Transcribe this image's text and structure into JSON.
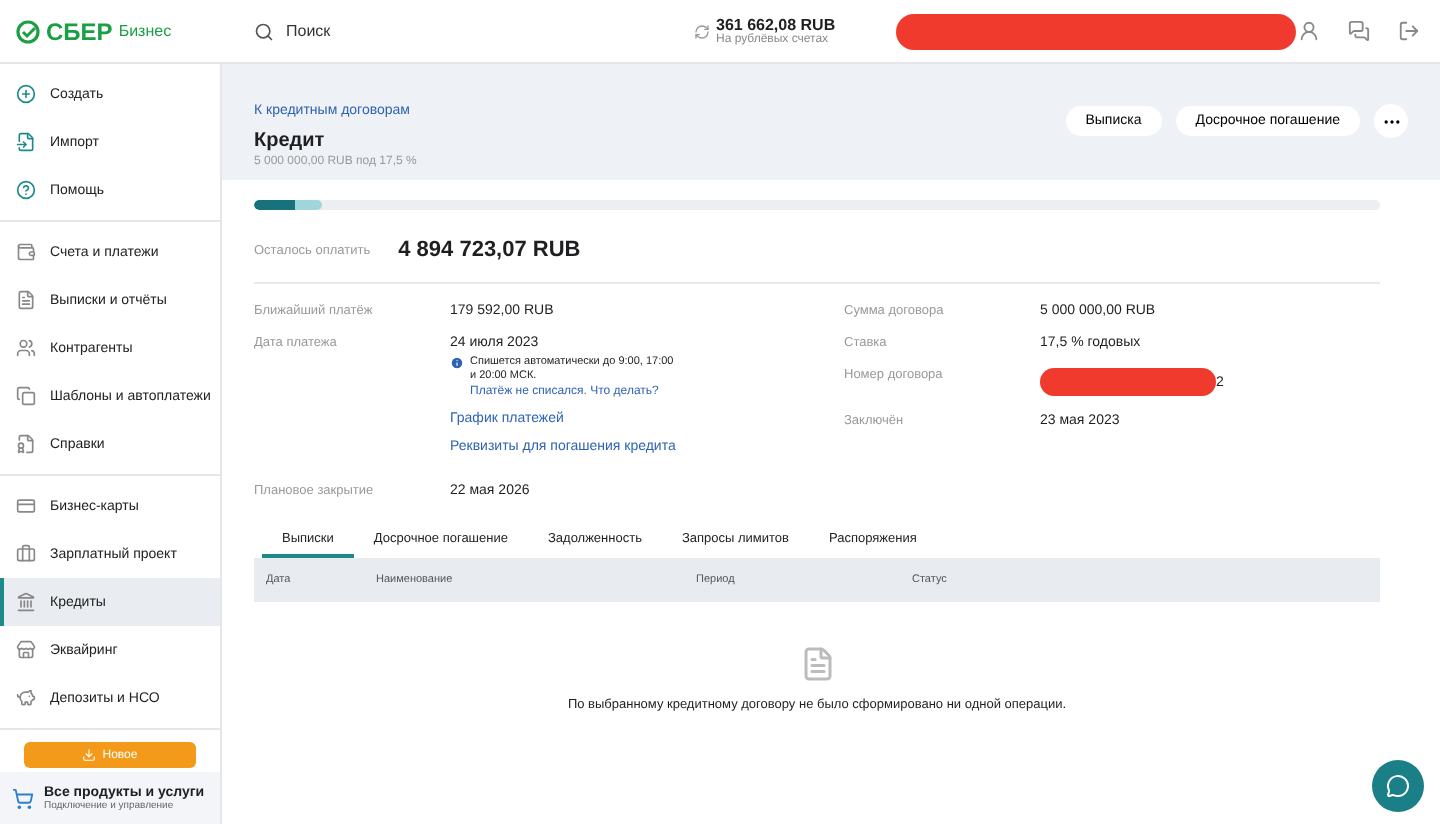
{
  "header": {
    "brand": "СБЕР",
    "product": "Бизнес",
    "search_placeholder": "Поиск",
    "balance": "361 662,08 RUB",
    "balance_caption": "На рублёвых счетах"
  },
  "sidebar": {
    "groups": [
      [
        {
          "label": "Создать",
          "selected": false
        },
        {
          "label": "Импорт",
          "selected": false
        },
        {
          "label": "Помощь",
          "selected": false
        }
      ],
      [
        {
          "label": "Счета и платежи",
          "selected": false
        },
        {
          "label": "Выписки и отчёты",
          "selected": false
        },
        {
          "label": "Контрагенты",
          "selected": false
        },
        {
          "label": "Шаблоны и автоплатежи",
          "selected": false
        },
        {
          "label": "Справки",
          "selected": false
        }
      ],
      [
        {
          "label": "Бизнес-карты",
          "selected": false
        },
        {
          "label": "Зарплатный проект",
          "selected": false
        },
        {
          "label": "Кредиты",
          "selected": true
        },
        {
          "label": "Эквайринг",
          "selected": false
        },
        {
          "label": "Депозиты и НСО",
          "selected": false
        }
      ]
    ],
    "new_button": "Новое",
    "footer_title": "Все продукты и услуги",
    "footer_caption": "Подключение и управление"
  },
  "page": {
    "breadcrumb": "К кредитным договорам",
    "title": "Кредит",
    "subtitle": "5 000 000,00 RUB под 17,5 %",
    "buttons": [
      "Выписка",
      "Досрочное погашение"
    ],
    "progress": {
      "level": 0.06
    },
    "remaining_label": "Осталось оплатить",
    "remaining_value": "4 894 723,07 RUB",
    "next_payment_label": "Ближайший платёж",
    "next_payment_value": "179 592,00 RUB",
    "payment_date_label": "Дата платежа",
    "payment_date_value": "24 июля 2023",
    "note": "Спишется автоматически до 9:00, 17:00 и 20:00 МСК.",
    "note_link": "Платёж не списался. Что делать?",
    "links": [
      "График платежей",
      "Реквизиты для погашения кредита"
    ],
    "planned_close_label": "Плановое закрытие",
    "planned_close_value": "22 мая 2026",
    "contract": [
      {
        "label": "Сумма договора",
        "value": "5 000 000,00 RUB"
      },
      {
        "label": "Ставка",
        "value": "17,5 % годовых"
      },
      {
        "label": "Номер договора",
        "value": "2"
      },
      {
        "label": "Заключён",
        "value": "23 мая 2023"
      }
    ],
    "tabs": [
      {
        "label": "Выписки",
        "selected": true
      },
      {
        "label": "Досрочное погашение",
        "selected": false
      },
      {
        "label": "Задолженность",
        "selected": false
      },
      {
        "label": "Запросы лимитов",
        "selected": false
      },
      {
        "label": "Распоряжения",
        "selected": false
      }
    ],
    "table": {
      "columns": [
        "Дата",
        "Наименование",
        "Период",
        "Статус"
      ]
    },
    "empty_message": "По выбранному кредитному договору не было сформировано ни одной операции."
  }
}
